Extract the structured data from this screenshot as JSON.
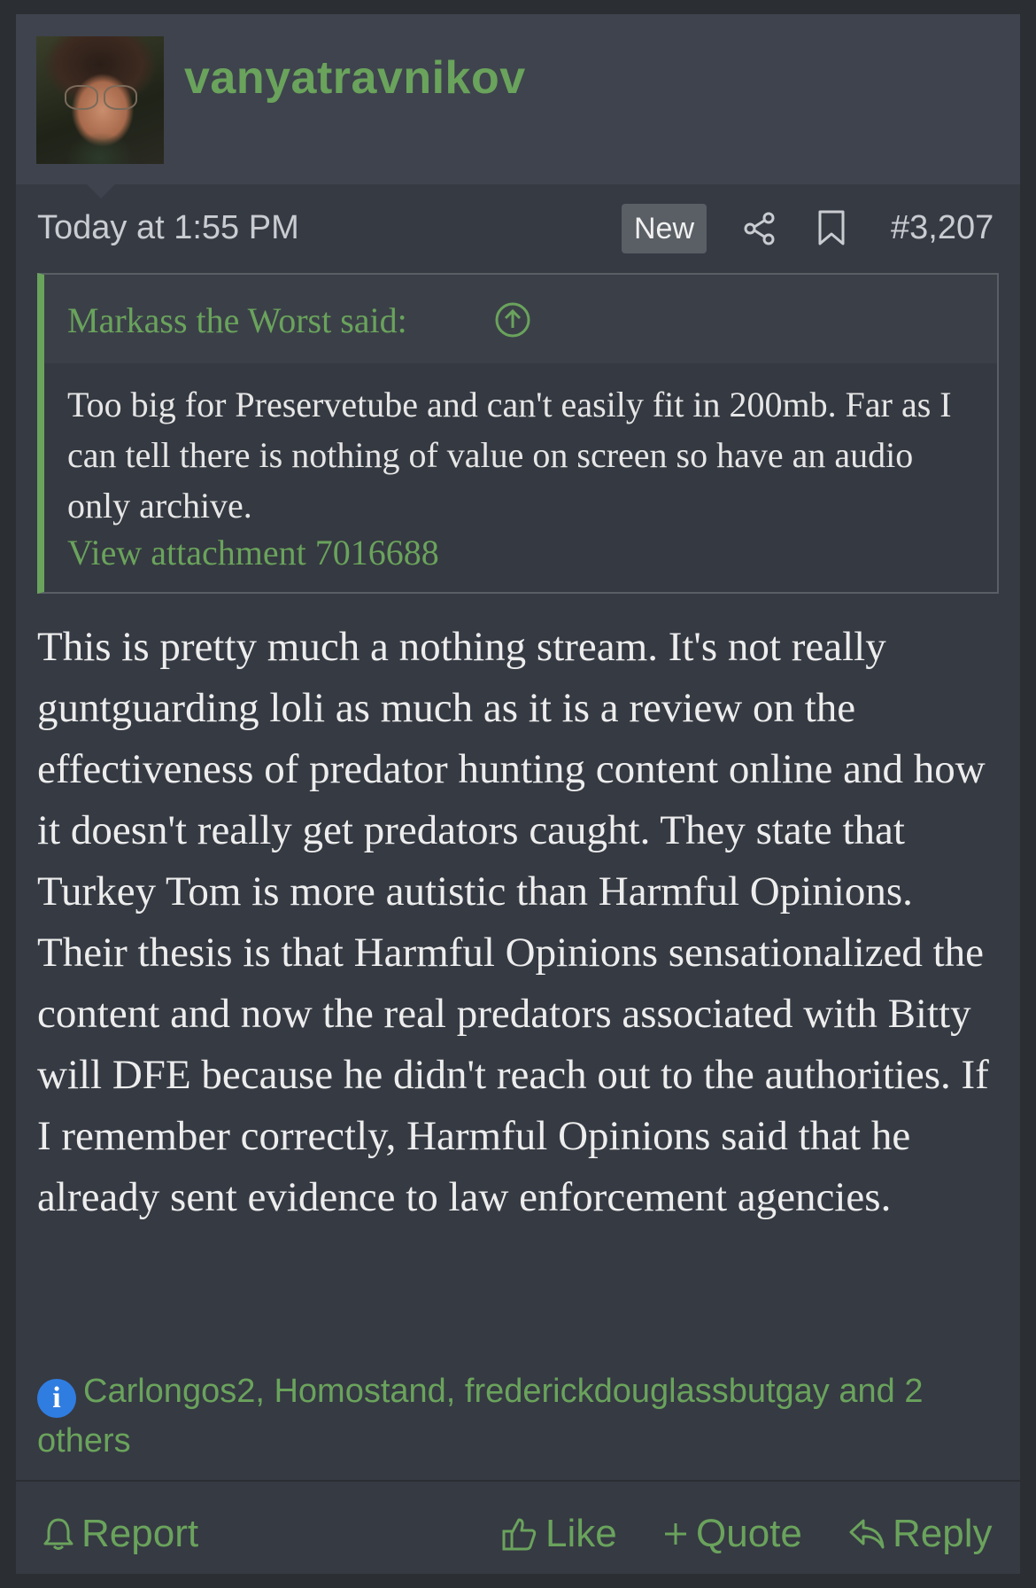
{
  "post": {
    "username": "vanyatravnikov",
    "time": "Today at 1:55 PM",
    "badge": "New",
    "post_number": "#3,207",
    "quote": {
      "author": "Markass the Worst said:",
      "text": "Too big for Preservetube and can't easily fit in 200mb. Far as I can tell there is nothing of value on screen so have an audio only archive.",
      "attachment": "View attachment 7016688"
    },
    "message": "This is pretty much a nothing stream. It's not really guntguarding loli as much as it is a review on the effectiveness of predator hunting content online and how it doesn't really get predators caught. They state that Turkey Tom is more autistic than Harmful Opinions. Their thesis is that Harmful Opinions sensationalized the content and now the real predators associated with Bitty will DFE because he didn't reach out to the authorities. If I remember correctly, Harmful Opinions said that he already sent evidence to law enforcement agencies.",
    "reactions": {
      "icon_letter": "i",
      "text": "Carlongos2, Homostand, frederickdouglassbutgay and 2 others"
    },
    "actions": {
      "report": "Report",
      "like": "Like",
      "quote": "Quote",
      "reply": "Reply"
    },
    "icons": {
      "share": "share-icon",
      "bookmark": "bookmark-icon",
      "up": "arrow-up-circle-icon",
      "info": "info-icon",
      "report": "bell-icon",
      "like": "thumbs-up-icon",
      "quote": "plus-icon",
      "reply": "reply-icon"
    },
    "colors": {
      "accent": "#6aa35c",
      "background": "#363a43",
      "header": "#3e434d",
      "info": "#2f7de1"
    }
  }
}
